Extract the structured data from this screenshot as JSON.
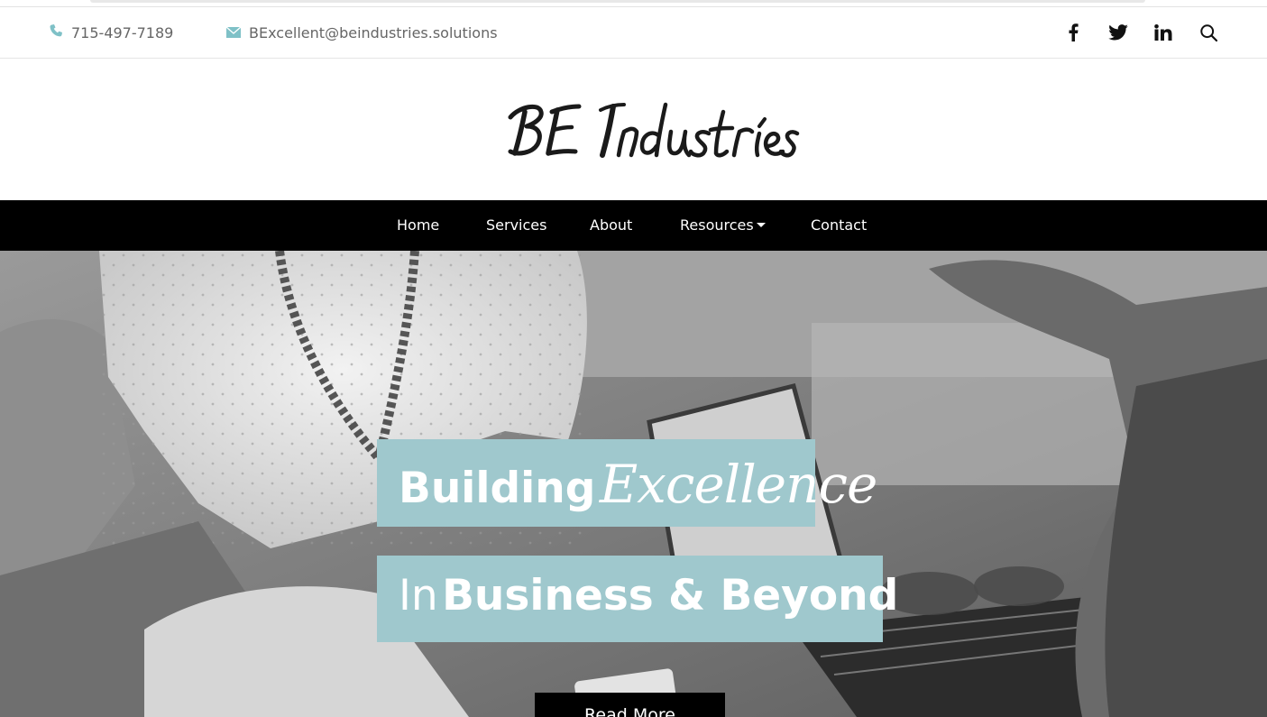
{
  "contact": {
    "phone": "715-497-7189",
    "email": "BExcellent@beindustries.solutions",
    "accent_color": "#7fc1c7"
  },
  "social": {
    "icons": [
      "facebook-icon",
      "twitter-icon",
      "linkedin-icon",
      "search-icon"
    ]
  },
  "brand": {
    "logo_text": "BE Industries"
  },
  "nav": {
    "items": [
      {
        "label": "Home"
      },
      {
        "label": "Services"
      },
      {
        "label": "About"
      },
      {
        "label": "Resources"
      },
      {
        "label": "Contact"
      }
    ]
  },
  "hero": {
    "line1_word1": "Building",
    "line1_word2": "Excellence",
    "line2_word1": "In",
    "line2_word2": "Business & Beyond",
    "button_label": "Read More",
    "banner_color": "#9fc8cd"
  }
}
